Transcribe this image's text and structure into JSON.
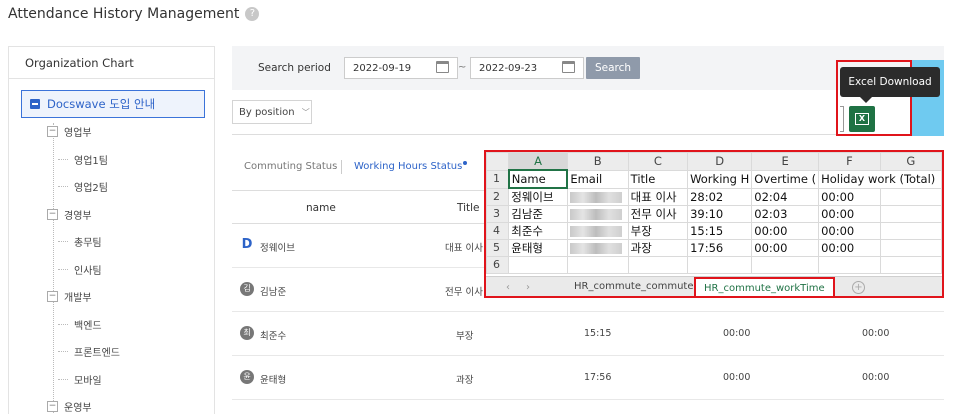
{
  "page": {
    "title": "Attendance History Management",
    "help_icon": "?"
  },
  "org": {
    "header": "Organization Chart",
    "root": "Docswave 도입 안내",
    "nodes": [
      {
        "label": "영업부",
        "level": 1
      },
      {
        "label": "영업1팀",
        "level": 2
      },
      {
        "label": "영업2팀",
        "level": 2
      },
      {
        "label": "경영부",
        "level": 1
      },
      {
        "label": "총무팀",
        "level": 2
      },
      {
        "label": "인사팀",
        "level": 2
      },
      {
        "label": "개발부",
        "level": 1
      },
      {
        "label": "백엔드",
        "level": 2
      },
      {
        "label": "프론트엔드",
        "level": 2
      },
      {
        "label": "모바일",
        "level": 2
      },
      {
        "label": "운영부",
        "level": 1
      }
    ]
  },
  "search": {
    "label": "Search period",
    "start_date": "2022-09-19",
    "separator": "~",
    "end_date": "2022-09-23",
    "button": "Search"
  },
  "filter": {
    "position_select": "By position"
  },
  "tabs": {
    "commuting": "Commuting Status",
    "working_hours": "Working Hours Status"
  },
  "table": {
    "headers": {
      "name": "name",
      "title": "Title"
    },
    "rows": [
      {
        "avatar": "D",
        "name": "정웨이브",
        "title": "대표 이사",
        "working": "28:02",
        "overtime": "02:04",
        "holiday": "00:00"
      },
      {
        "avatar": "김",
        "name": "김남준",
        "title": "전무 이사",
        "working": "39:10",
        "overtime": "02:03",
        "holiday": "00:00"
      },
      {
        "avatar": "최",
        "name": "최준수",
        "title": "부장",
        "working": "15:15",
        "overtime": "00:00",
        "holiday": "00:00"
      },
      {
        "avatar": "윤",
        "name": "윤태형",
        "title": "과장",
        "working": "17:56",
        "overtime": "00:00",
        "holiday": "00:00"
      }
    ]
  },
  "excel": {
    "tooltip": "Excel Download",
    "icon_letter": "X",
    "icon": "excel-icon"
  },
  "spreadsheet": {
    "columns": [
      "A",
      "B",
      "C",
      "D",
      "E",
      "F",
      "G"
    ],
    "row_numbers": [
      "1",
      "2",
      "3",
      "4",
      "5",
      "6"
    ],
    "header_row": [
      "Name",
      "Email",
      "Title",
      "Working H",
      "Overtime (",
      "Holiday work (Total)"
    ],
    "data_rows": [
      [
        "정웨이브",
        "",
        "대표 이사",
        "28:02",
        "02:04",
        "00:00"
      ],
      [
        "김남준",
        "",
        "전무 이사",
        "39:10",
        "02:03",
        "00:00"
      ],
      [
        "최준수",
        "",
        "부장",
        "15:15",
        "00:00",
        "00:00"
      ],
      [
        "윤태형",
        "",
        "과장",
        "17:56",
        "00:00",
        "00:00"
      ]
    ],
    "sheet_tabs": [
      "HR_commute_commute",
      "HR_commute_workTime"
    ],
    "add_sheet": "+"
  },
  "colors": {
    "accent": "#2d63c8",
    "excel_green": "#217346",
    "highlight_red": "#e0141b",
    "strip_blue": "#6fcaf0"
  }
}
